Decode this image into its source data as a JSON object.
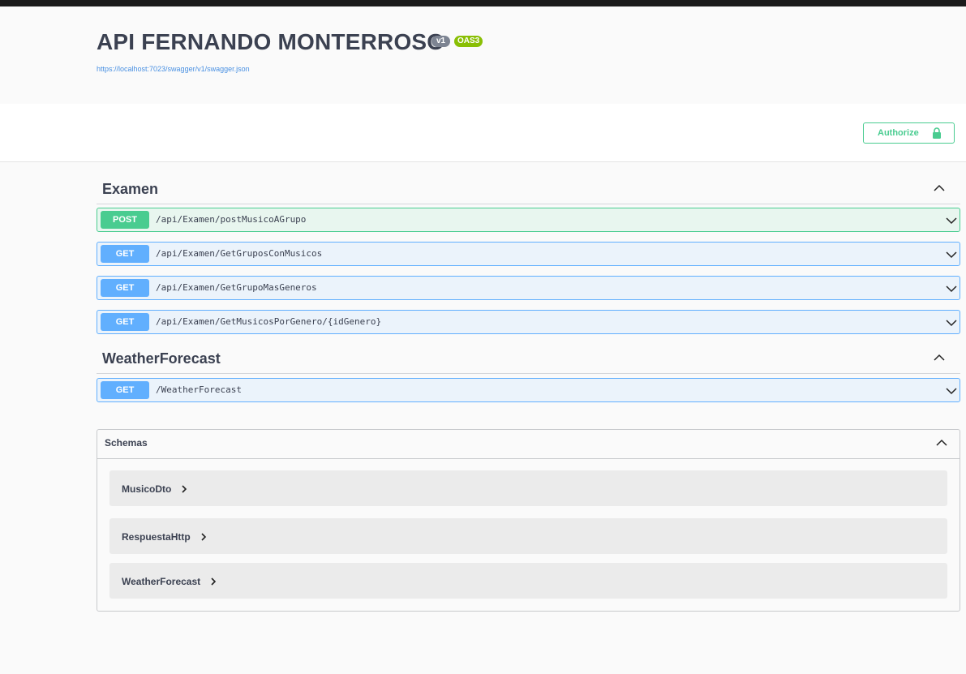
{
  "header": {
    "title": "API FERNANDO MONTERROSO",
    "version_badge": "v1",
    "oas_badge": "OAS3",
    "spec_url": "https://localhost:7023/swagger/v1/swagger.json"
  },
  "authorize": {
    "label": "Authorize"
  },
  "tags": [
    {
      "name": "Examen",
      "operations": [
        {
          "method": "POST",
          "path": "/api/Examen/postMusicoAGrupo"
        },
        {
          "method": "GET",
          "path": "/api/Examen/GetGruposConMusicos"
        },
        {
          "method": "GET",
          "path": "/api/Examen/GetGrupoMasGeneros"
        },
        {
          "method": "GET",
          "path": "/api/Examen/GetMusicosPorGenero/{idGenero}"
        }
      ]
    },
    {
      "name": "WeatherForecast",
      "operations": [
        {
          "method": "GET",
          "path": "/WeatherForecast"
        }
      ]
    }
  ],
  "schemas": {
    "title": "Schemas",
    "models": [
      "MusicoDto",
      "RespuestaHttp",
      "WeatherForecast"
    ]
  },
  "colors": {
    "post": "#49cc90",
    "get": "#61affe",
    "title": "#3b4151",
    "link": "#4990e2",
    "oas_badge": "#89bf04",
    "version_badge": "#7d8492"
  },
  "icons": {
    "lock": "lock-icon",
    "collapse": "chevron-up-icon",
    "expand": "chevron-down-icon",
    "model_expand": "chevron-right-icon"
  }
}
